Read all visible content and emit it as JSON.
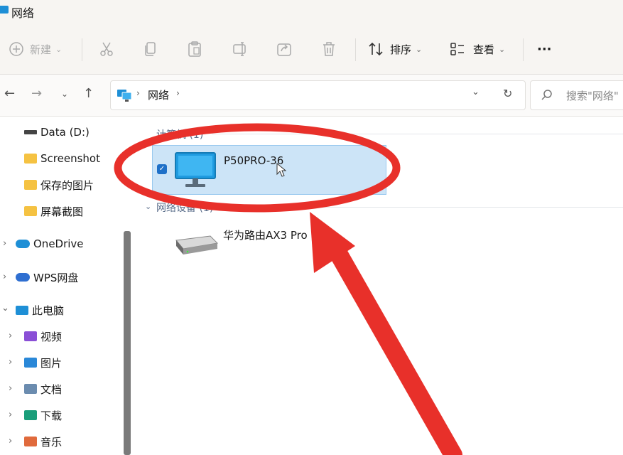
{
  "window": {
    "title": "网络"
  },
  "toolbar": {
    "new_label": "新建",
    "sort_label": "排序",
    "view_label": "查看",
    "more_label": "···"
  },
  "address": {
    "location": "网络"
  },
  "search": {
    "placeholder": "搜索\"网络\""
  },
  "sidebar": {
    "items": [
      {
        "label": "Data (D:)"
      },
      {
        "label": "Screenshot"
      },
      {
        "label": "保存的图片"
      },
      {
        "label": "屏幕截图"
      },
      {
        "label": "OneDrive"
      },
      {
        "label": "WPS网盘"
      },
      {
        "label": "此电脑"
      },
      {
        "label": "视频"
      },
      {
        "label": "图片"
      },
      {
        "label": "文档"
      },
      {
        "label": "下载"
      },
      {
        "label": "音乐"
      }
    ]
  },
  "content": {
    "groups": [
      {
        "header": "计算机 (1)",
        "items": [
          {
            "name": "P50PRO-36",
            "selected": true
          }
        ]
      },
      {
        "header": "网络设备 (1)",
        "items": [
          {
            "name": "华为路由AX3 Pro"
          }
        ]
      }
    ]
  },
  "colors": {
    "annotation": "#e8302a",
    "selection": "#cce4f7",
    "accent": "#1e8fd6"
  }
}
